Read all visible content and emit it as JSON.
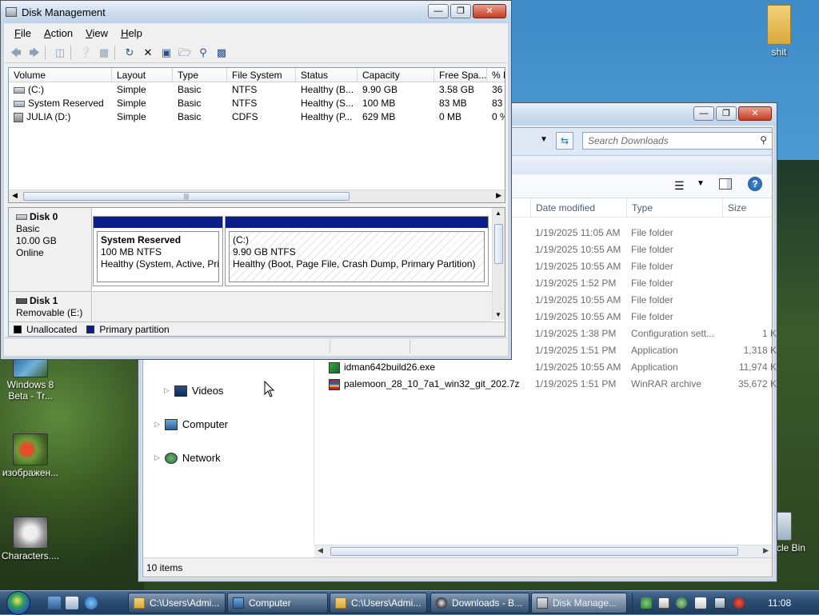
{
  "desktop": {
    "icons": [
      {
        "label": "shit"
      },
      {
        "label": "Windows 8 Beta - Tr..."
      },
      {
        "label": "изображен..."
      },
      {
        "label": "Characters...."
      },
      {
        "label": "cle Bin"
      }
    ]
  },
  "disk_management": {
    "title": "Disk Management",
    "menu": [
      "File",
      "Action",
      "View",
      "Help"
    ],
    "volume_columns": [
      "Volume",
      "Layout",
      "Type",
      "File System",
      "Status",
      "Capacity",
      "Free Spa...",
      "% F"
    ],
    "volumes": [
      {
        "volume": "(C:)",
        "layout": "Simple",
        "type": "Basic",
        "fs": "NTFS",
        "status": "Healthy (B...",
        "capacity": "9.90 GB",
        "free": "3.58 GB",
        "pct": "36"
      },
      {
        "volume": "System Reserved",
        "layout": "Simple",
        "type": "Basic",
        "fs": "NTFS",
        "status": "Healthy (S...",
        "capacity": "100 MB",
        "free": "83 MB",
        "pct": "83"
      },
      {
        "volume": "JULIA (D:)",
        "layout": "Simple",
        "type": "Basic",
        "fs": "CDFS",
        "status": "Healthy (P...",
        "capacity": "629 MB",
        "free": "0 MB",
        "pct": "0 %"
      }
    ],
    "disks": [
      {
        "name": "Disk 0",
        "kind": "Basic",
        "size": "10.00 GB",
        "state": "Online"
      },
      {
        "name": "Disk 1",
        "kind": "Removable (E:)"
      }
    ],
    "partitions": [
      {
        "name": "System Reserved",
        "size": "100 MB NTFS",
        "status": "Healthy (System, Active, Prir"
      },
      {
        "name": "(C:)",
        "size": "9.90 GB NTFS",
        "status": "Healthy (Boot, Page File, Crash Dump, Primary Partition)"
      }
    ],
    "legend": [
      {
        "label": "Unallocated",
        "color": "#000000"
      },
      {
        "label": "Primary partition",
        "color": "#0a1f8a"
      }
    ]
  },
  "explorer": {
    "search_placeholder": "Search Downloads",
    "nav": [
      {
        "label": "Videos"
      },
      {
        "label": "Computer"
      },
      {
        "label": "Network"
      }
    ],
    "columns": [
      "Date modified",
      "Type",
      "Size"
    ],
    "files": [
      {
        "name": "",
        "date": "1/19/2025 11:05 AM",
        "type": "File folder",
        "size": ""
      },
      {
        "name": "",
        "date": "1/19/2025 10:55 AM",
        "type": "File folder",
        "size": ""
      },
      {
        "name": "",
        "date": "1/19/2025 10:55 AM",
        "type": "File folder",
        "size": ""
      },
      {
        "name": "",
        "date": "1/19/2025 1:52 PM",
        "type": "File folder",
        "size": ""
      },
      {
        "name": "",
        "date": "1/19/2025 10:55 AM",
        "type": "File folder",
        "size": ""
      },
      {
        "name": "",
        "date": "1/19/2025 10:55 AM",
        "type": "File folder",
        "size": ""
      },
      {
        "name": "",
        "date": "1/19/2025 1:38 PM",
        "type": "Configuration sett...",
        "size": "1 K"
      },
      {
        "name": "",
        "date": "1/19/2025 1:51 PM",
        "type": "Application",
        "size": "1,318 K"
      },
      {
        "name": "idman642build26.exe",
        "date": "1/19/2025 10:55 AM",
        "type": "Application",
        "size": "11,974 K"
      },
      {
        "name": "palemoon_28_10_7a1_win32_git_202.7z",
        "date": "1/19/2025 1:51 PM",
        "type": "WinRAR archive",
        "size": "35,672 K"
      }
    ],
    "status": "10 items"
  },
  "taskbar": {
    "buttons": [
      {
        "label": "C:\\Users\\Admi..."
      },
      {
        "label": "Computer"
      },
      {
        "label": "C:\\Users\\Admi..."
      },
      {
        "label": "Downloads - B..."
      },
      {
        "label": "Disk Manage..."
      }
    ],
    "clock": "11:08"
  }
}
